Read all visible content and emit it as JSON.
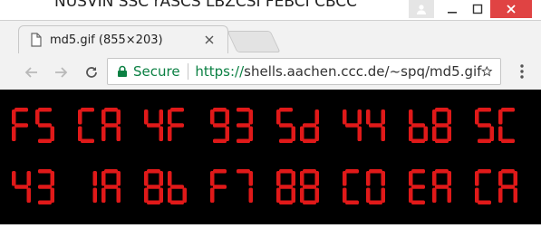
{
  "window": {
    "background_title": "NUSVIN SSC rASCS LBZCSI FEBCI CBCC"
  },
  "tab": {
    "title": "md5.gif (855×203)"
  },
  "toolbar": {
    "secure_label": "Secure",
    "url_scheme": "https://",
    "url_rest": "shells.aachen.ccc.de/~spq/md5.gif"
  },
  "content": {
    "rows": [
      [
        "F5",
        "CA",
        "4F",
        "93",
        "5d",
        "44",
        "b8",
        "5C"
      ],
      [
        "43",
        "1A",
        "8b",
        "F7",
        "88",
        "C0",
        "EA",
        "CA"
      ]
    ],
    "digit_color": "#e01919"
  }
}
